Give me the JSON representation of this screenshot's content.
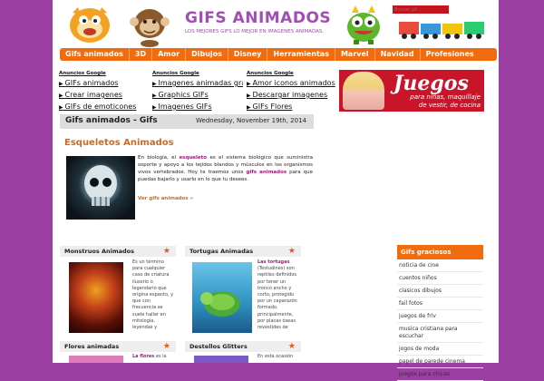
{
  "header": {
    "title": "GIFS ANIMADOS",
    "tagline": "LOS MEJORES GIFS LO MEJOR EN IMAGENES ANIMADAS.",
    "search_placeholder": "Buscar gif..."
  },
  "nav": [
    "Gifs animados",
    "3D",
    "Amor",
    "Dibujos",
    "Disney",
    "Herramientas",
    "Marvel",
    "Navidad",
    "Profesiones"
  ],
  "ads": [
    {
      "head": "Anuncios Google",
      "links": [
        "GIFs animados",
        "Crear imagenes",
        "GIFs de emoticones"
      ]
    },
    {
      "head": "Anuncios Google",
      "links": [
        "Imagenes animadas gra",
        "Graphics GIFs",
        "Imagenes GIFs"
      ]
    },
    {
      "head": "Anuncios Google",
      "links": [
        "Amor iconos animados",
        "Descargar imagenes",
        "GIFs Flores"
      ]
    }
  ],
  "banner": {
    "title": "Juegos",
    "subtitle_line1": "para niñas, maquillaje",
    "subtitle_line2": "de vestir, de cocina"
  },
  "section": {
    "left": "Gifs animados - Gifs",
    "date": "Wednesday, November 19th, 2014"
  },
  "article": {
    "title": "Esqueletos Animados",
    "text_before": "En biología, el ",
    "keyword": "esqueleto",
    "text_after": " es el sistema biológico que suministra soporte y apoyo a los tejidos blandos y músculos en los organismos vivos vertebrados. Hoy te traemos unos ",
    "keyword2": "gifs animados",
    "text_end": " para que puedas bajarlo y usarlo en lo que tu desees.",
    "more": "Ver gifs animados »"
  },
  "cards": [
    {
      "title": "Monstruos Animados",
      "lead": "",
      "text": "Es un término para cualquier caso de criatura ilusorio o legendario que origina espanto, y que con frecuencia se suele hallar en mitología, leyendas y",
      "bold": "criatura"
    },
    {
      "title": "Tortugas Animadas",
      "lead": "Las tortugas",
      "text": "(Testudines) son reptiles definidos por tener un tronco ancho y corto, protegido por un caparazón formado, principalmente, por placas óseas revestidas de"
    },
    {
      "title": "Flores animadas",
      "lead": "La flores",
      "text": "es la"
    },
    {
      "title": "Destellos Glitters",
      "lead": "",
      "text": "En esta ocasión"
    }
  ],
  "sidebar": {
    "title": "Gifs graciosos",
    "items": [
      "noticia de cine",
      "cuentos niños",
      "clasicos dibujos",
      "fail fotos",
      "juegos de friv",
      "musica cristiana para escuchar",
      "jogos de moda",
      "papel de parede cinema",
      "juegos para chicas"
    ]
  },
  "colors": {
    "background": "#9b3fa3",
    "accent": "#f16b0f",
    "brand": "#a14db3",
    "link": "#d2691e"
  }
}
